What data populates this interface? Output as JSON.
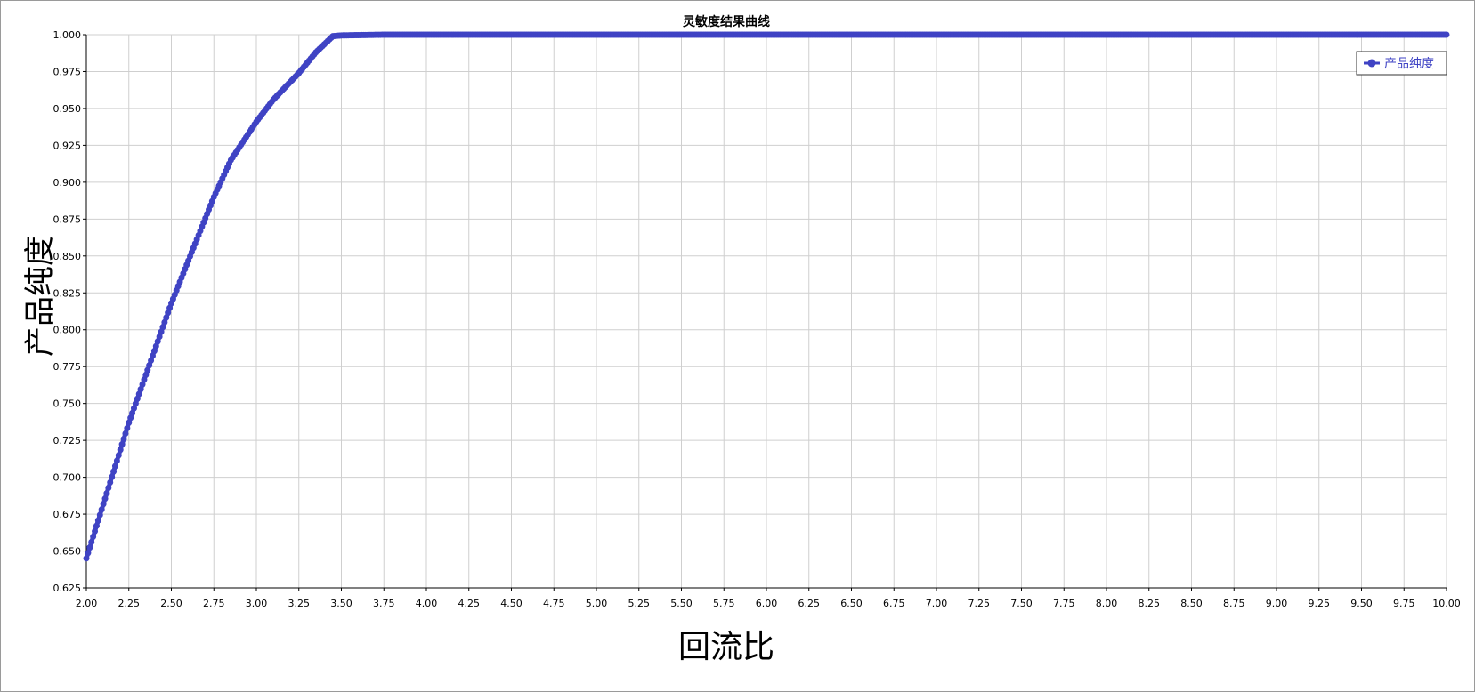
{
  "chart_data": {
    "type": "line",
    "title": "灵敏度结果曲线",
    "xlabel": "回流比",
    "ylabel": "产品纯度",
    "xlim": [
      2.0,
      10.0
    ],
    "ylim": [
      0.625,
      1.0
    ],
    "x_ticks": [
      "2.00",
      "2.25",
      "2.50",
      "2.75",
      "3.00",
      "3.25",
      "3.50",
      "3.75",
      "4.00",
      "4.25",
      "4.50",
      "4.75",
      "5.00",
      "5.25",
      "5.50",
      "5.75",
      "6.00",
      "6.25",
      "6.50",
      "6.75",
      "7.00",
      "7.25",
      "7.50",
      "7.75",
      "8.00",
      "8.25",
      "8.50",
      "8.75",
      "9.00",
      "9.25",
      "9.50",
      "9.75",
      "10.00"
    ],
    "y_ticks": [
      "0.625",
      "0.650",
      "0.675",
      "0.700",
      "0.725",
      "0.750",
      "0.775",
      "0.800",
      "0.825",
      "0.850",
      "0.875",
      "0.900",
      "0.925",
      "0.950",
      "0.975",
      "1.000"
    ],
    "grid": true,
    "legend_position": "top-right",
    "series": [
      {
        "name": "产品纯度",
        "color": "#3f43c4",
        "marker": "circle",
        "x": [
          2.0,
          2.25,
          2.5,
          2.75,
          2.85,
          3.0,
          3.1,
          3.25,
          3.35,
          3.45,
          3.5,
          3.75,
          4.0,
          5.0,
          6.0,
          7.0,
          8.0,
          9.0,
          10.0
        ],
        "y": [
          0.645,
          0.737,
          0.818,
          0.89,
          0.915,
          0.941,
          0.956,
          0.974,
          0.988,
          0.999,
          0.9995,
          1.0,
          1.0,
          1.0,
          1.0,
          1.0,
          1.0,
          1.0,
          1.0
        ]
      }
    ]
  }
}
